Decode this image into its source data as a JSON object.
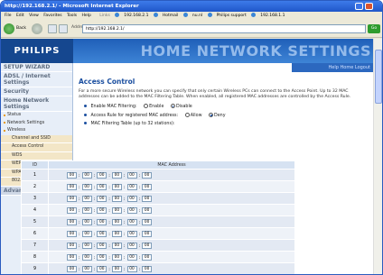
{
  "window": {
    "title": "http://192.168.2.1/ - Microsoft Internet Explorer"
  },
  "menu": [
    "File",
    "Edit",
    "View",
    "Favorites",
    "Tools",
    "Help"
  ],
  "links": {
    "label": "Links",
    "items": [
      "192.168.2.1",
      "Hotmail",
      "nu.nl",
      "Philips support",
      "192.168.1.1"
    ]
  },
  "toolbar": {
    "back_label": "Back",
    "address_label": "Address",
    "address_value": "http://192.168.2.1/",
    "go_label": "Go"
  },
  "header": {
    "brand": "PHILIPS",
    "title": "HOME NETWORK SETTINGS",
    "links": "Help  Home  Logout"
  },
  "sidebar": {
    "setup_wizard": "SETUP WIZARD",
    "adsl": "ADSL / Internet Settings",
    "security": "Security",
    "home_network": "Home Network Settings",
    "items": [
      "Status",
      "Network Settings",
      "Wireless"
    ],
    "wireless_items": [
      "Channel and SSID",
      "Access Control",
      "WDS",
      "WEP",
      "WPA",
      "802.1X"
    ],
    "advanced": "Advanced Settings"
  },
  "main": {
    "title": "Access Control",
    "description": "For a more secure Wireless network you can specify that only certain Wireless PCs can connect to the Access Point. Up to 32 MAC addresses can be added to the MAC Filtering Table. When enabled, all registered MAC addresses are controlled by the Access Rule.",
    "mac_filter_label": "Enable MAC Filtering:",
    "mac_filter_options": [
      "Enable",
      "Disable"
    ],
    "mac_filter_selected": "Disable",
    "access_rule_label": "Access Rule for registered MAC address:",
    "access_rule_options": [
      "Allow",
      "Deny"
    ],
    "access_rule_selected": "Deny",
    "table_label": "MAC Filtering Table (up to 32 stations):",
    "table_headers": [
      "ID",
      "MAC Address"
    ],
    "rows": [
      {
        "id": "1",
        "mac": [
          "00",
          "00",
          "00",
          "00",
          "00",
          "00"
        ]
      },
      {
        "id": "2",
        "mac": [
          "00",
          "00",
          "00",
          "00",
          "00",
          "00"
        ]
      },
      {
        "id": "3",
        "mac": [
          "00",
          "00",
          "00",
          "00",
          "00",
          "00"
        ]
      },
      {
        "id": "4",
        "mac": [
          "00",
          "00",
          "00",
          "00",
          "00",
          "00"
        ]
      },
      {
        "id": "5",
        "mac": [
          "00",
          "00",
          "00",
          "00",
          "00",
          "00"
        ]
      },
      {
        "id": "6",
        "mac": [
          "00",
          "00",
          "00",
          "00",
          "00",
          "00"
        ]
      },
      {
        "id": "7",
        "mac": [
          "00",
          "00",
          "00",
          "00",
          "00",
          "00"
        ]
      },
      {
        "id": "8",
        "mac": [
          "00",
          "00",
          "00",
          "00",
          "00",
          "00"
        ]
      },
      {
        "id": "9",
        "mac": [
          "00",
          "00",
          "00",
          "00",
          "00",
          "00"
        ]
      }
    ]
  }
}
